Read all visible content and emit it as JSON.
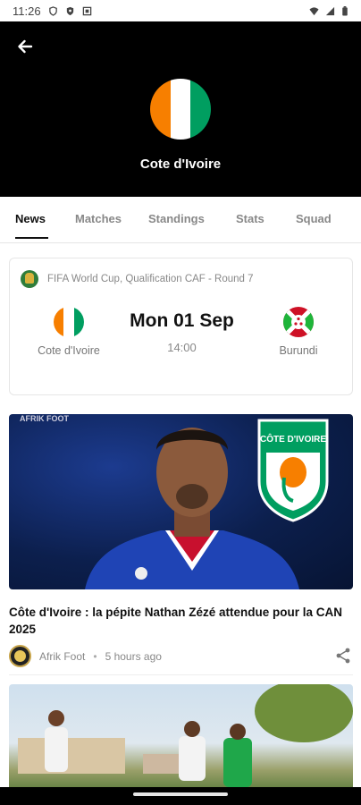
{
  "status_bar": {
    "time": "11:26",
    "left_icons": [
      "shield-icon",
      "vpn-shield-icon",
      "notification-square-icon"
    ],
    "right_icons": [
      "wifi-icon",
      "signal-icon",
      "battery-icon"
    ]
  },
  "header": {
    "back_icon": "arrow-back-icon",
    "team_name": "Cote d'Ivoire",
    "flag_colors": [
      "#F77F00",
      "#FFFFFF",
      "#009E60"
    ]
  },
  "tabs": [
    {
      "label": "News",
      "active": true
    },
    {
      "label": "Matches",
      "active": false
    },
    {
      "label": "Standings",
      "active": false
    },
    {
      "label": "Stats",
      "active": false
    },
    {
      "label": "Squad",
      "active": false
    }
  ],
  "match": {
    "competition": "FIFA World Cup, Qualification CAF - Round 7",
    "home_team": "Cote d'Ivoire",
    "away_team": "Burundi",
    "date": "Mon 01 Sep",
    "time": "14:00"
  },
  "news": [
    {
      "image_tag": "AFRIK FOOT",
      "headline": "Côte d'Ivoire : la pépite Nathan Zézé attendue pour la CAN 2025",
      "source": "Afrik Foot",
      "time_ago": "5 hours ago",
      "share_icon": "share-icon"
    }
  ],
  "crest_text": "CÔTE D'IVOIRE",
  "colors": {
    "accent": "#111111",
    "muted": "#888888"
  }
}
